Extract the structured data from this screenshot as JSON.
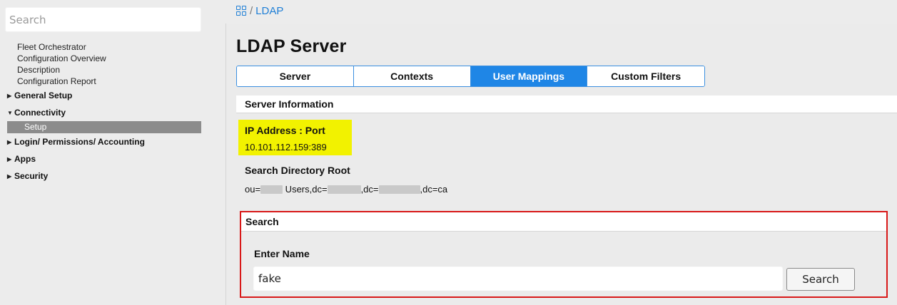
{
  "sidebar": {
    "search_placeholder": "Search",
    "items": [
      {
        "label": "Fleet Orchestrator"
      },
      {
        "label": "Configuration Overview"
      },
      {
        "label": "Description"
      },
      {
        "label": "Configuration Report"
      }
    ],
    "groups": {
      "general_setup": {
        "label": "General Setup",
        "expanded": false
      },
      "connectivity": {
        "label": "Connectivity",
        "expanded": true,
        "children": [
          {
            "label": "Setup",
            "active": true
          }
        ]
      },
      "login": {
        "label": "Login/ Permissions/ Accounting",
        "expanded": false
      },
      "apps": {
        "label": "Apps",
        "expanded": false
      },
      "security": {
        "label": "Security",
        "expanded": false
      }
    },
    "icons": {
      "collapsed": "triangle-right-icon",
      "expanded": "triangle-down-icon"
    }
  },
  "breadcrumb": {
    "home_icon": "grid-home-icon",
    "separator": "/",
    "current": "LDAP"
  },
  "page": {
    "title": "LDAP Server",
    "tabs": [
      {
        "label": "Server",
        "active": false
      },
      {
        "label": "Contexts",
        "active": false
      },
      {
        "label": "User Mappings",
        "active": true
      },
      {
        "label": "Custom Filters",
        "active": false
      }
    ]
  },
  "server_info": {
    "header": "Server Information",
    "ip_label": "IP Address : Port",
    "ip_value": "10.101.112.159:389",
    "root_label": "Search Directory Root",
    "root_parts": [
      "ou=",
      " Users,dc=",
      ",dc=",
      ",dc=ca"
    ]
  },
  "search": {
    "header": "Search",
    "enter_label": "Enter Name",
    "name_value": "fake",
    "button_label": "Search"
  },
  "colors": {
    "accent": "#1f86e6",
    "highlight": "#f2f200",
    "callout_border": "#d81818",
    "active_nav": "#8c8c8c"
  }
}
